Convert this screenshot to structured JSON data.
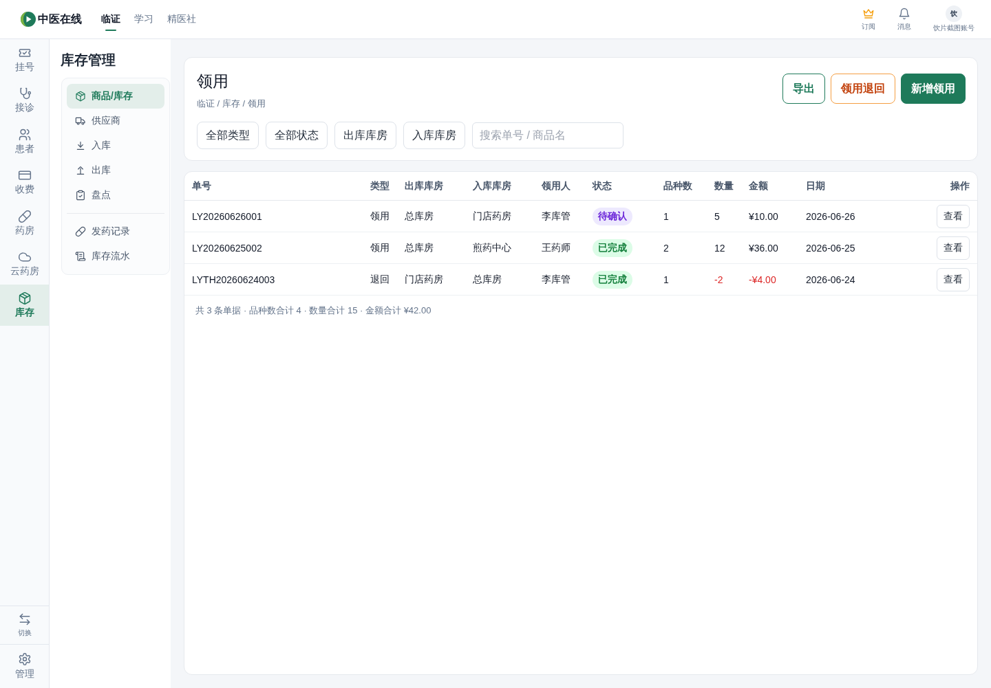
{
  "topbar": {
    "brand": "中医在线",
    "nav": [
      {
        "label": "临证",
        "selected": true
      },
      {
        "label": "学习",
        "selected": false
      },
      {
        "label": "精医社",
        "selected": false
      }
    ],
    "actions": [
      {
        "label": "订阅",
        "kind": "crown"
      },
      {
        "label": "消息",
        "kind": "bell"
      }
    ],
    "account": {
      "avatar": "饮",
      "name": "饮片截图账号"
    }
  },
  "rail": {
    "items": [
      {
        "label": "挂号",
        "selected": false
      },
      {
        "label": "接诊",
        "selected": false
      },
      {
        "label": "患者",
        "selected": false
      },
      {
        "label": "收费",
        "selected": false
      },
      {
        "label": "药房",
        "selected": false
      },
      {
        "label": "云药房",
        "selected": false
      },
      {
        "label": "库存",
        "selected": true
      }
    ],
    "bottom": [
      {
        "label": "切换"
      },
      {
        "label": "管理"
      }
    ]
  },
  "subnav": {
    "title": "库存管理",
    "groups": [
      [
        {
          "label": "商品/库存",
          "selected": true
        },
        {
          "label": "供应商",
          "selected": false
        },
        {
          "label": "入库",
          "selected": false
        },
        {
          "label": "出库",
          "selected": false
        },
        {
          "label": "盘点",
          "selected": false
        }
      ],
      [
        {
          "label": "发药记录",
          "selected": false
        },
        {
          "label": "库存流水",
          "selected": false
        }
      ]
    ]
  },
  "page": {
    "title": "领用",
    "breadcrumb": "临证 / 库存 / 领用",
    "buttons": [
      {
        "label": "导出",
        "kind": "outline"
      },
      {
        "label": "领用退回",
        "kind": "warning"
      },
      {
        "label": "新增领用",
        "kind": "primary"
      }
    ],
    "filters": [
      "全部类型",
      "全部状态",
      "出库库房",
      "入库库房"
    ],
    "search": {
      "placeholder": "搜索单号 / 商品名"
    }
  },
  "table": {
    "columns": [
      "单号",
      "类型",
      "出库库房",
      "入库库房",
      "领用人",
      "状态",
      "品种数",
      "数量",
      "金额",
      "日期",
      "操作"
    ],
    "rows": [
      {
        "number": "LY20260626001",
        "type": "领用",
        "from": "总库房",
        "to": "门店药房",
        "recipient": "李库管",
        "status": {
          "text": "待确认",
          "kind": "pending"
        },
        "varieties": "1",
        "quantity": "5",
        "amount": "¥10.00",
        "date": "2026-06-26",
        "action": "查看",
        "negative": false
      },
      {
        "number": "LY20260625002",
        "type": "领用",
        "from": "总库房",
        "to": "煎药中心",
        "recipient": "王药师",
        "status": {
          "text": "已完成",
          "kind": "done"
        },
        "varieties": "2",
        "quantity": "12",
        "amount": "¥36.00",
        "date": "2026-06-25",
        "action": "查看",
        "negative": false
      },
      {
        "number": "LYTH20260624003",
        "type": "退回",
        "from": "门店药房",
        "to": "总库房",
        "recipient": "李库管",
        "status": {
          "text": "已完成",
          "kind": "done"
        },
        "varieties": "1",
        "quantity": "-2",
        "amount": "-¥4.00",
        "date": "2026-06-24",
        "action": "查看",
        "negative": true
      }
    ],
    "summary": "共 3 条单据 · 品种数合计 4 · 数量合计 15 · 金额合计 ¥42.00"
  }
}
